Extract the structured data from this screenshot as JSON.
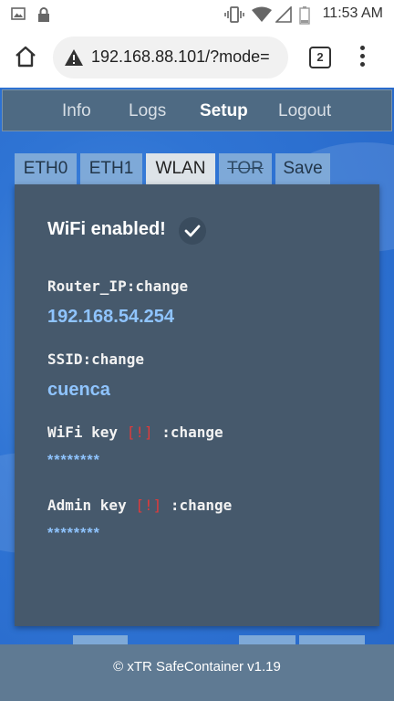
{
  "status_bar": {
    "time": "11:53 AM",
    "icons": [
      "image-icon",
      "lock-icon",
      "vibrate-icon",
      "wifi-icon",
      "signal-icon",
      "battery-icon"
    ]
  },
  "browser": {
    "url": "192.168.88.101/?mode=",
    "tab_count": "2",
    "icons": [
      "home-icon",
      "warning-icon",
      "tabs-icon",
      "overflow-menu-icon"
    ]
  },
  "nav": {
    "items": [
      {
        "label": "Info"
      },
      {
        "label": "Logs"
      },
      {
        "label": "Setup"
      },
      {
        "label": "Logout"
      }
    ],
    "active": "Setup"
  },
  "tabs": [
    {
      "label": "ETH0"
    },
    {
      "label": "ETH1"
    },
    {
      "label": "WLAN"
    },
    {
      "label": "TOR"
    },
    {
      "label": "Save"
    }
  ],
  "panel": {
    "title": "WiFi enabled!",
    "fields": [
      {
        "name": "Router_IP",
        "change": ":change",
        "value": "192.168.54.254"
      },
      {
        "name": "SSID",
        "change": ":change",
        "value": "cuenca"
      },
      {
        "name": "WiFi key ",
        "warning": "[!]",
        "change": " :change",
        "value": "********"
      },
      {
        "name": "Admin key ",
        "warning": "[!]",
        "change": " :change",
        "value": "********"
      }
    ]
  },
  "footer": {
    "text": "©  xTR SafeContainer v1.19"
  },
  "colors": {
    "nav_bg": "#4e6a83",
    "panel_bg": "#46596c",
    "value_text": "#8fc4ff",
    "warning_text": "#e03a3a",
    "page_bg": "#2f74d4",
    "footer_bg": "#5f7a93"
  }
}
